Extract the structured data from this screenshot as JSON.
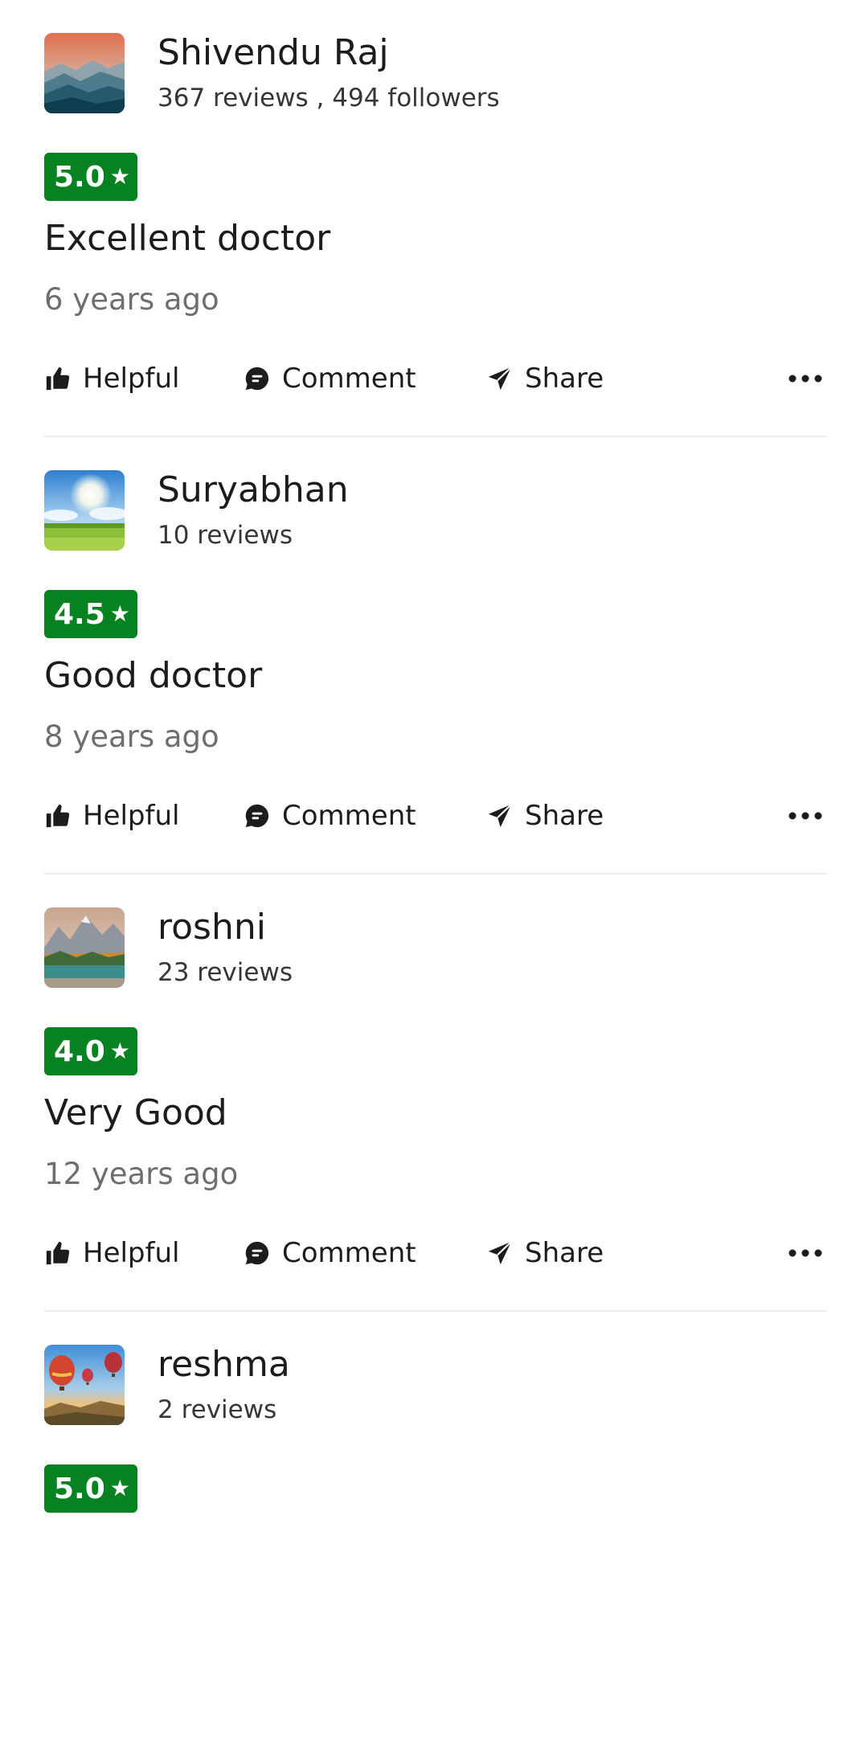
{
  "reviews": [
    {
      "user_name": "Shivendu Raj",
      "user_stats": "367 reviews , 494 followers",
      "rating": "5.0",
      "text": "Excellent doctor",
      "time": "6 years ago",
      "avatar_icon": "mountain-sunset-avatar"
    },
    {
      "user_name": "Suryabhan",
      "user_stats": "10 reviews",
      "rating": "4.5",
      "text": "Good doctor",
      "time": "8 years ago",
      "avatar_icon": "sunny-meadow-avatar"
    },
    {
      "user_name": "roshni",
      "user_stats": "23 reviews",
      "rating": "4.0",
      "text": "Very Good",
      "time": "12 years ago",
      "avatar_icon": "mountain-lake-avatar"
    },
    {
      "user_name": "reshma",
      "user_stats": "2 reviews",
      "rating": "5.0",
      "avatar_icon": "hot-air-balloons-avatar"
    }
  ],
  "actions": {
    "helpful": "Helpful",
    "comment": "Comment",
    "share": "Share"
  },
  "rating_star": "★",
  "colors": {
    "rating_badge": "#078220",
    "time_text": "#6e6e6e",
    "divider": "#ececec"
  }
}
